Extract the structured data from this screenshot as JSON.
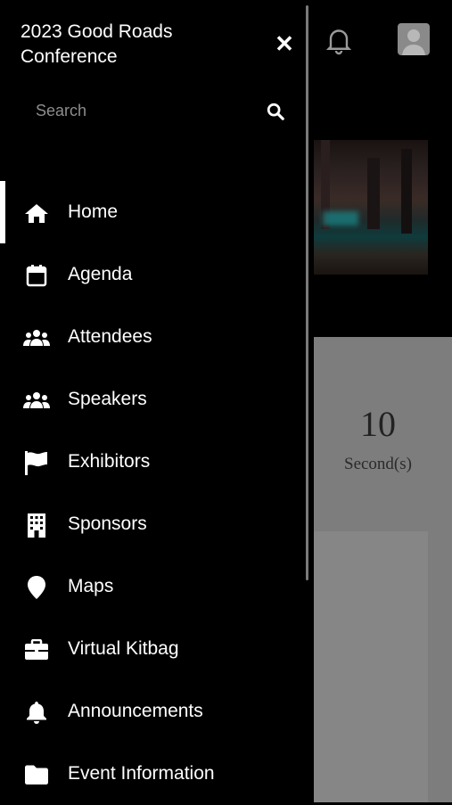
{
  "drawer": {
    "title": "2023 Good Roads Conference",
    "search_placeholder": "Search",
    "items": [
      {
        "label": "Home",
        "icon": "home-icon",
        "active": true
      },
      {
        "label": "Agenda",
        "icon": "calendar-icon",
        "active": false
      },
      {
        "label": "Attendees",
        "icon": "users-icon",
        "active": false
      },
      {
        "label": "Speakers",
        "icon": "users-icon",
        "active": false
      },
      {
        "label": "Exhibitors",
        "icon": "flag-icon",
        "active": false
      },
      {
        "label": "Sponsors",
        "icon": "building-icon",
        "active": false
      },
      {
        "label": "Maps",
        "icon": "map-pin-icon",
        "active": false
      },
      {
        "label": "Virtual Kitbag",
        "icon": "briefcase-icon",
        "active": false
      },
      {
        "label": "Announcements",
        "icon": "bell-icon",
        "active": false
      },
      {
        "label": "Event Information",
        "icon": "folder-icon",
        "active": false
      }
    ]
  },
  "countdown": {
    "value": "10",
    "unit": "Second(s)"
  },
  "colors": {
    "drawer_bg": "#000000",
    "text": "#ffffff",
    "placeholder": "#8d8d8d",
    "overlay_panel": "#7d7d7d"
  }
}
